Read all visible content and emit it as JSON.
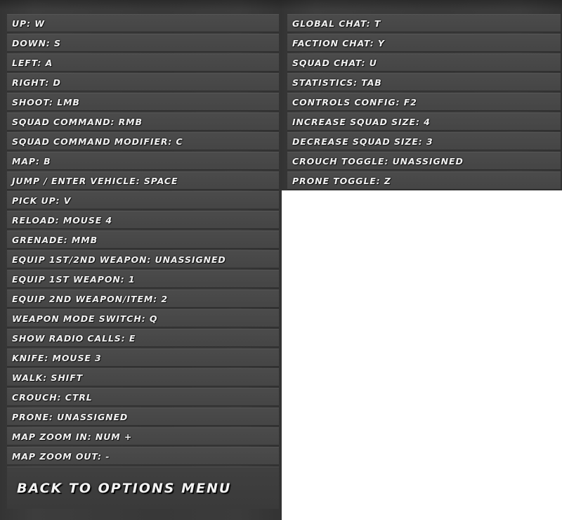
{
  "controls": {
    "left_column": [
      "UP: W",
      "DOWN: S",
      "LEFT: A",
      "RIGHT: D",
      "SHOOT: LMB",
      "SQUAD COMMAND: RMB",
      "SQUAD COMMAND MODIFIER: C",
      "MAP: B",
      "JUMP / ENTER VEHICLE: SPACE",
      "PICK UP: V",
      "RELOAD: MOUSE 4",
      "GRENADE: MMB",
      "EQUIP 1ST/2ND WEAPON: UNASSIGNED",
      "EQUIP 1ST WEAPON: 1",
      "EQUIP 2ND WEAPON/ITEM: 2",
      "WEAPON MODE SWITCH: Q",
      "SHOW RADIO CALLS: E",
      "KNIFE: MOUSE 3",
      "WALK: SHIFT",
      "CROUCH: CTRL",
      "PRONE: UNASSIGNED",
      "MAP ZOOM IN: NUM +",
      "MAP ZOOM OUT: -"
    ],
    "right_column": [
      "GLOBAL CHAT: T",
      "FACTION CHAT: Y",
      "SQUAD CHAT: U",
      "STATISTICS: TAB",
      "CONTROLS CONFIG: F2",
      "INCREASE SQUAD SIZE: 4",
      "DECREASE SQUAD SIZE: 3",
      "CROUCH TOGGLE: UNASSIGNED",
      "PRONE TOGGLE: Z"
    ]
  },
  "back_button": {
    "label": "BACK TO OPTIONS MENU"
  }
}
